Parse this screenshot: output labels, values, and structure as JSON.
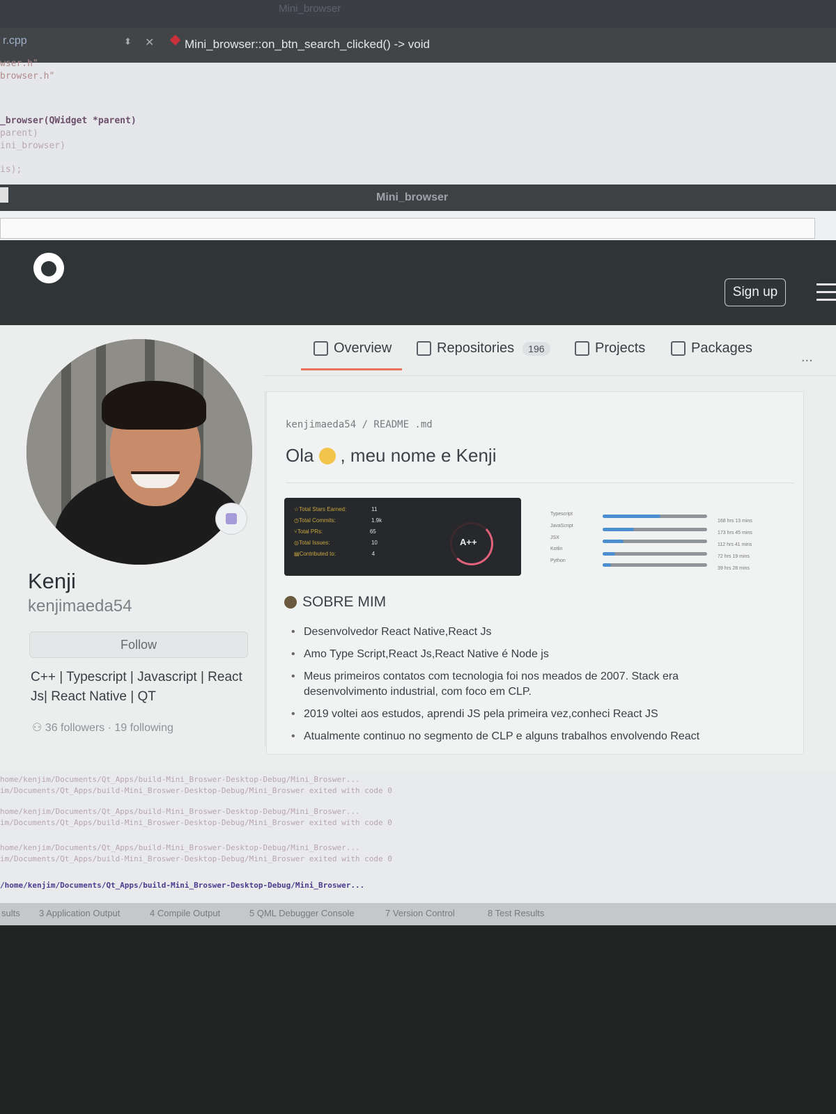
{
  "qt": {
    "window_title": "Mini_browser",
    "editor_file": "r.cpp",
    "function_selector": "Mini_browser::on_btn_search_clicked() -> void",
    "code_lines": [
      "wser.h\"",
      "browser.h\"",
      "_browser(QWidget *parent)",
      "parent)",
      "ini_browser)",
      "is);"
    ],
    "output_lines": [
      "home/kenjim/Documents/Qt_Apps/build-Mini_Broswer-Desktop-Debug/Mini_Broswer...",
      "im/Documents/Qt_Apps/build-Mini_Broswer-Desktop-Debug/Mini_Broswer exited with code 0",
      "home/kenjim/Documents/Qt_Apps/build-Mini_Broswer-Desktop-Debug/Mini_Broswer...",
      "im/Documents/Qt_Apps/build-Mini_Broswer-Desktop-Debug/Mini_Broswer exited with code 0",
      "home/kenjim/Documents/Qt_Apps/build-Mini_Broswer-Desktop-Debug/Mini_Broswer...",
      "im/Documents/Qt_Apps/build-Mini_Broswer-Desktop-Debug/Mini_Broswer exited with code 0",
      "/home/kenjim/Documents/Qt_Apps/build-Mini_Broswer-Desktop-Debug/Mini_Broswer..."
    ],
    "bottom_tabs": [
      "sults",
      "3 Application Output",
      "4 Compile Output",
      "5 QML Debugger Console",
      "7 Version Control",
      "8 Test Results"
    ]
  },
  "browser": {
    "title": "Mini_browser",
    "url_value": ""
  },
  "github": {
    "signup_label": "Sign up",
    "tabs": [
      {
        "label": "Overview"
      },
      {
        "label": "Repositories",
        "count": "196"
      },
      {
        "label": "Projects"
      },
      {
        "label": "Packages"
      }
    ],
    "more_label": "...",
    "profile": {
      "name": "Kenji",
      "username": "kenjimaeda54",
      "follow_label": "Follow",
      "bio": "C++ | Typescript | Javascript | React Js| React Native | QT",
      "followers_text": "36 followers · 19 following"
    },
    "readme": {
      "path": "kenjimaeda54 / README .md",
      "title_pre": "Ola",
      "title_post": ", meu nome e Kenji",
      "stats": [
        {
          "label": "Total Stars Earned:",
          "value": "11"
        },
        {
          "label": "Total Commits:",
          "value": "1.9k"
        },
        {
          "label": "Total PRs:",
          "value": "65"
        },
        {
          "label": "Total Issues:",
          "value": "10"
        },
        {
          "label": "Contributed to:",
          "value": "4"
        }
      ],
      "grade": "A++",
      "languages": [
        {
          "name": "Typescript",
          "time": "168 hrs 13 mins",
          "fraction": 0.55
        },
        {
          "name": "JavaScript",
          "time": "173 hrs 45 mins",
          "fraction": 0.3
        },
        {
          "name": "JSX",
          "time": "112 hrs 41 mins",
          "fraction": 0.2
        },
        {
          "name": "Kotlin",
          "time": "72 hrs 19 mins",
          "fraction": 0.12
        },
        {
          "name": "Python",
          "time": "39 hrs 28 mins",
          "fraction": 0.08
        }
      ],
      "about_title": "SOBRE MIM",
      "about_items": [
        "Desenvolvedor React Native,React Js",
        "Amo Type Script,React Js,React Native é Node js",
        "Meus primeiros contatos com tecnologia foi nos meados de 2007. Stack era desenvolvimento industrial, com foco em CLP.",
        "2019 voltei aos estudos, aprendi JS pela primeira vez,conheci React JS",
        "Atualmente continuo no segmento de CLP e alguns trabalhos envolvendo React"
      ]
    }
  }
}
